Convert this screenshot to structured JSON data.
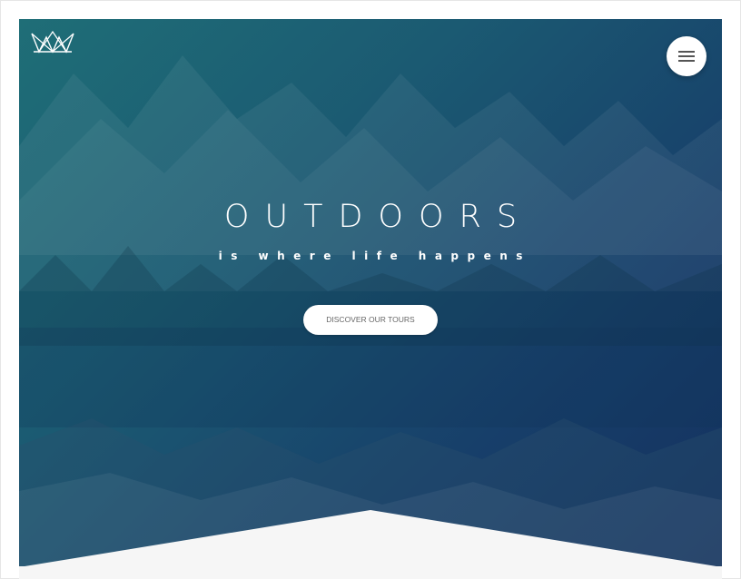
{
  "hero": {
    "headline": "OUTDOORS",
    "tagline": "IS WHERE LIFE HAPPENS",
    "cta_label": "DISCOVER OUR TOURS"
  },
  "icons": {
    "logo": "crown-logo-icon",
    "menu": "hamburger-menu-icon"
  },
  "colors": {
    "gradient_start": "#1f6e77",
    "gradient_end": "#14305e",
    "cta_background": "#ffffff",
    "footer_background": "#f6f6f6"
  }
}
